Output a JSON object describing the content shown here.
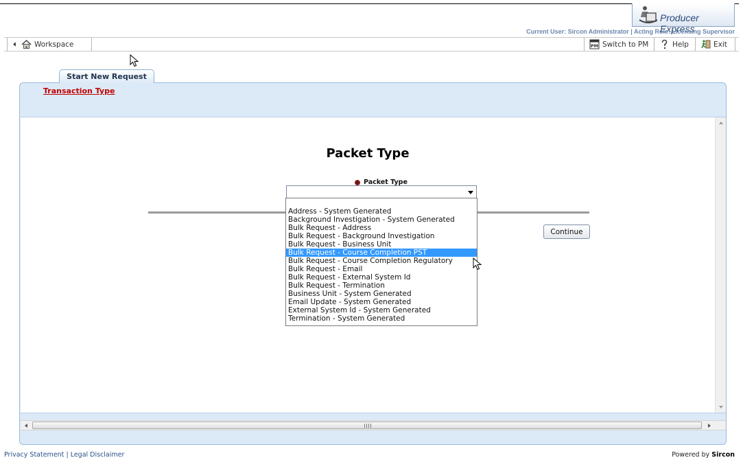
{
  "app": {
    "brand": "Producer Express",
    "user_info": "Current User: Sircon Administrator | Acting Role: Licensing Supervisor"
  },
  "toolbar": {
    "workspace_label": "Workspace",
    "switch_label": "Switch to PM",
    "help_label": "Help",
    "exit_label": "Exit"
  },
  "tab": {
    "label": "Start New Request"
  },
  "breadcrumb": {
    "label": "Transaction Type"
  },
  "main": {
    "heading": "Packet Type",
    "field_label": "Packet Type",
    "selected_value": "",
    "continue_label": "Continue"
  },
  "dropdown": {
    "options": [
      "Address - System Generated",
      "Background Investigation - System Generated",
      "Bulk Request - Address",
      "Bulk Request - Background Investigation",
      "Bulk Request - Business Unit",
      "Bulk Request - Course Completion PST",
      "Bulk Request - Course Completion Regulatory",
      "Bulk Request - Email",
      "Bulk Request - External System Id",
      "Bulk Request - Termination",
      "Business Unit - System Generated",
      "Email Update - System Generated",
      "External System Id - System Generated",
      "Termination - System Generated"
    ],
    "highlighted_index": 5
  },
  "footer": {
    "privacy": "Privacy Statement",
    "separator": "|",
    "legal": "Legal Disclaimer",
    "powered_prefix": "Powered by",
    "powered_brand": "Sircon"
  },
  "colors": {
    "accent_blue": "#3399ff",
    "panel_bg": "#dceaf8",
    "breadcrumb_red": "#c00000"
  },
  "icons": {
    "brand": "producer-express-logo",
    "workspace": "home-icon",
    "back": "back-arrow-icon",
    "switch": "pm-icon",
    "help": "help-icon",
    "exit": "exit-icon",
    "required": "required-marker-icon"
  }
}
